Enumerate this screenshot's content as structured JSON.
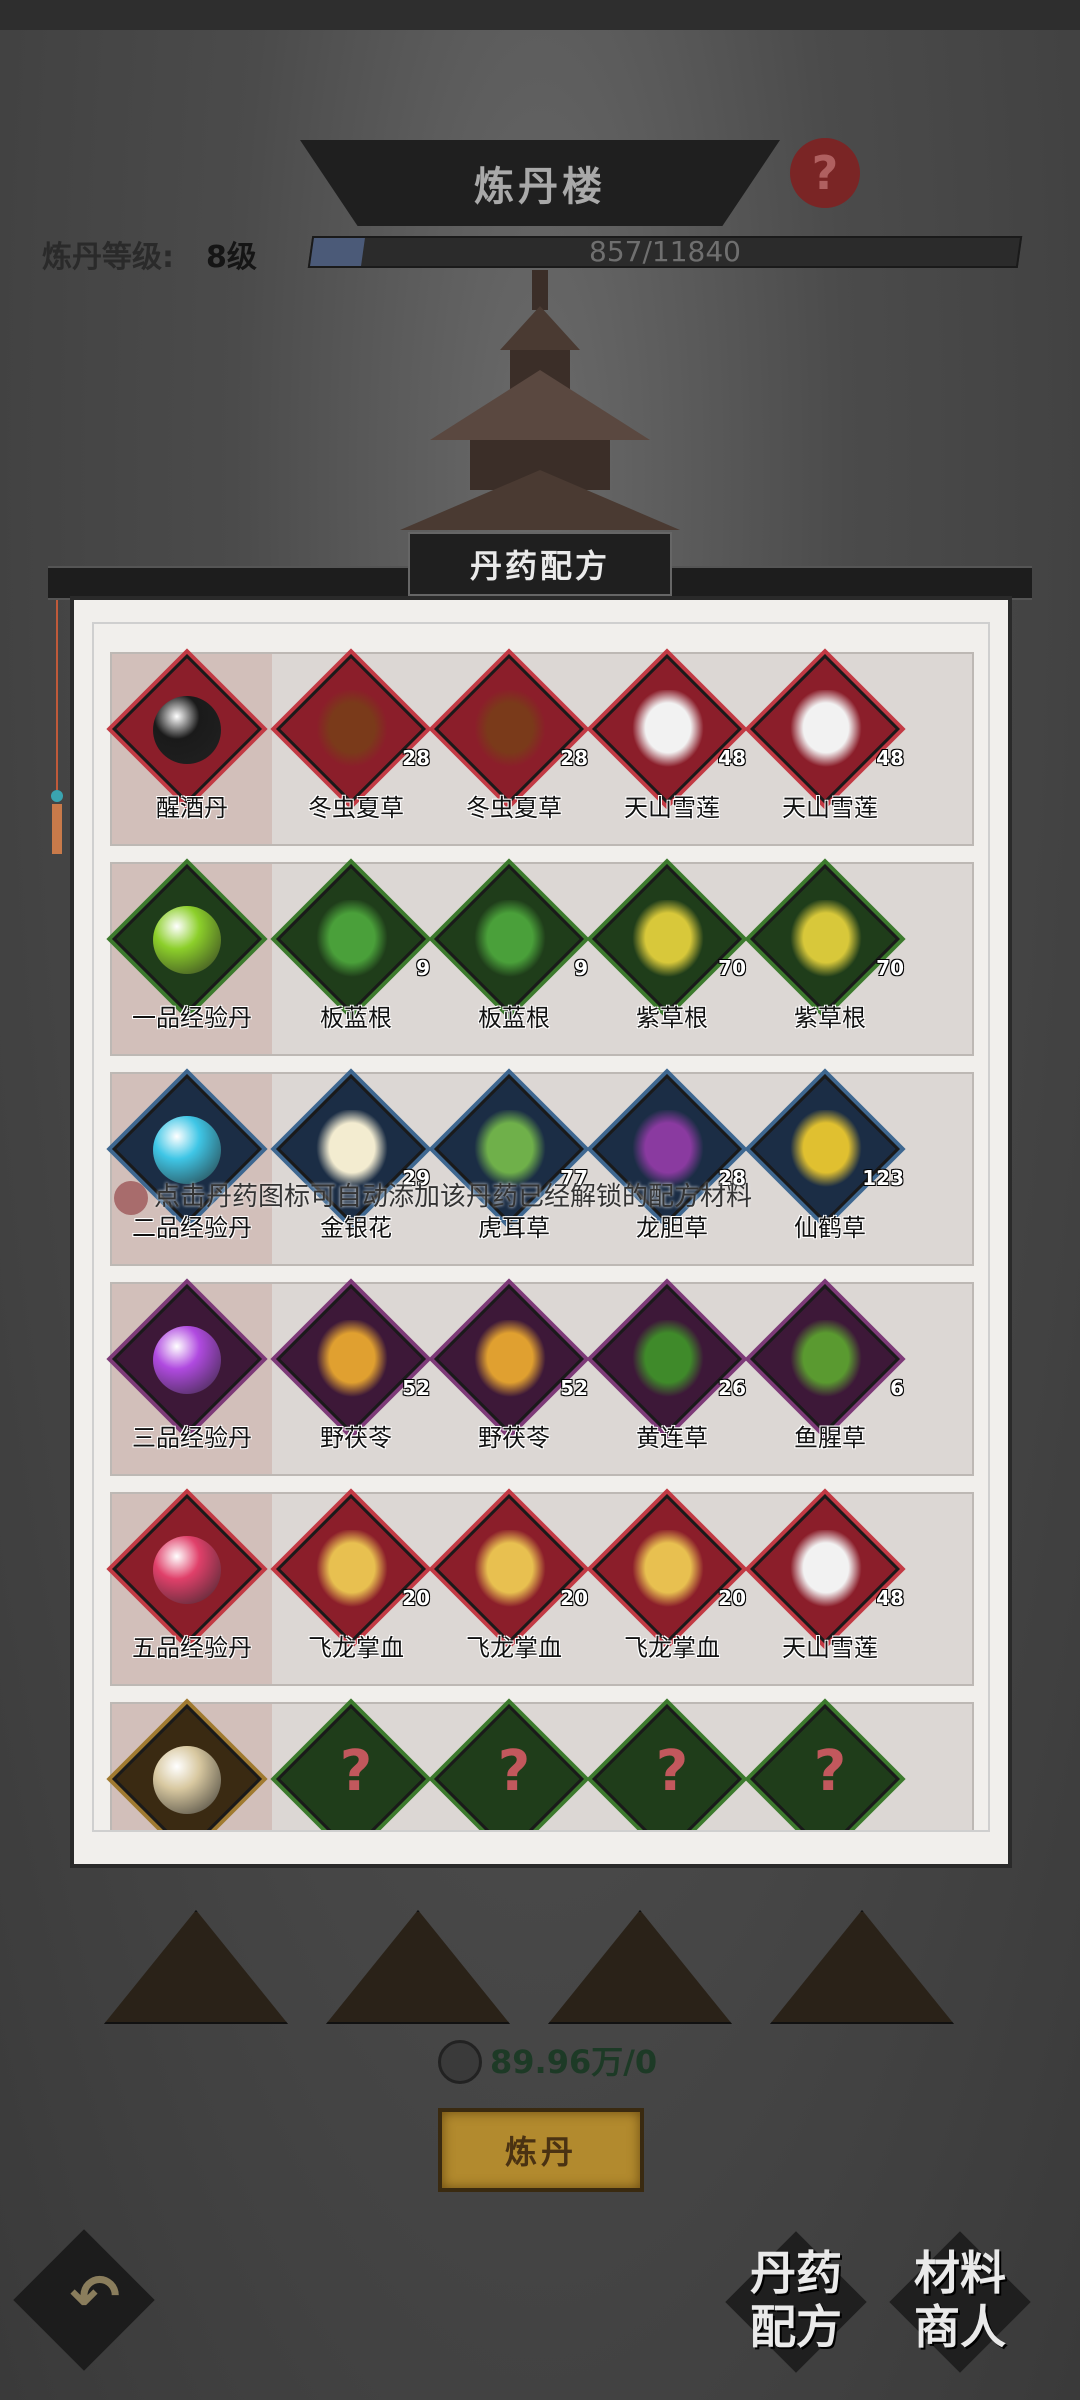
{
  "header": {
    "title": "炼丹楼",
    "help_icon": "?",
    "level_label": "炼丹等级:",
    "level_value": "8级",
    "xp_text": "857/11840",
    "xp_progress": 0.0724
  },
  "panel": {
    "title": "丹药配方",
    "hint_text": "点击丹药图标可自动添加该丹药已经解锁的配方材料"
  },
  "recipes": [
    {
      "pill": {
        "name": "醒酒丹",
        "color": "#1a1a1a",
        "frame": "red"
      },
      "ingredients": [
        {
          "name": "冬虫夏草",
          "count": "28",
          "frame": "red",
          "icon": "cordyceps-icon"
        },
        {
          "name": "冬虫夏草",
          "count": "28",
          "frame": "red",
          "icon": "cordyceps-icon"
        },
        {
          "name": "天山雪莲",
          "count": "48",
          "frame": "red",
          "icon": "snow-lotus-icon"
        },
        {
          "name": "天山雪莲",
          "count": "48",
          "frame": "red",
          "icon": "snow-lotus-icon"
        }
      ]
    },
    {
      "pill": {
        "name": "一品经验丹",
        "color": "#8ccf2a",
        "frame": "green"
      },
      "ingredients": [
        {
          "name": "板蓝根",
          "count": "9",
          "frame": "green",
          "icon": "isatis-root-icon"
        },
        {
          "name": "板蓝根",
          "count": "9",
          "frame": "green",
          "icon": "isatis-root-icon"
        },
        {
          "name": "紫草根",
          "count": "70",
          "frame": "green",
          "icon": "purple-gromwell-icon"
        },
        {
          "name": "紫草根",
          "count": "70",
          "frame": "green",
          "icon": "purple-gromwell-icon"
        }
      ]
    },
    {
      "pill": {
        "name": "二品经验丹",
        "color": "#3fc6e6",
        "frame": "blue"
      },
      "ingredients": [
        {
          "name": "金银花",
          "count": "29",
          "frame": "blue",
          "icon": "honeysuckle-icon"
        },
        {
          "name": "虎耳草",
          "count": "77",
          "frame": "blue",
          "icon": "saxifrage-icon"
        },
        {
          "name": "龙胆草",
          "count": "28",
          "frame": "blue",
          "icon": "gentian-icon"
        },
        {
          "name": "仙鹤草",
          "count": "123",
          "frame": "blue",
          "icon": "agrimony-icon"
        }
      ]
    },
    {
      "pill": {
        "name": "三品经验丹",
        "color": "#b04ae0",
        "frame": "purple"
      },
      "ingredients": [
        {
          "name": "野茯苓",
          "count": "52",
          "frame": "purple",
          "icon": "poria-icon"
        },
        {
          "name": "野茯苓",
          "count": "52",
          "frame": "purple",
          "icon": "poria-icon"
        },
        {
          "name": "黄连草",
          "count": "26",
          "frame": "purple",
          "icon": "coptis-icon"
        },
        {
          "name": "鱼腥草",
          "count": "6",
          "frame": "purple",
          "icon": "houttuynia-icon"
        }
      ]
    },
    {
      "pill": {
        "name": "五品经验丹",
        "color": "#e0406a",
        "frame": "red"
      },
      "ingredients": [
        {
          "name": "飞龙掌血",
          "count": "20",
          "frame": "red",
          "icon": "toddalia-icon"
        },
        {
          "name": "飞龙掌血",
          "count": "20",
          "frame": "red",
          "icon": "toddalia-icon"
        },
        {
          "name": "飞龙掌血",
          "count": "20",
          "frame": "red",
          "icon": "toddalia-icon"
        },
        {
          "name": "天山雪莲",
          "count": "48",
          "frame": "red",
          "icon": "snow-lotus-icon"
        }
      ]
    }
  ],
  "locked_row": {
    "question": "?",
    "frame": "green"
  },
  "footer": {
    "cost_text": "89.96万/0",
    "alchemy_button": "炼丹",
    "recipe_button_line1": "丹药",
    "recipe_button_line2": "配方",
    "merchant_button_line1": "材料",
    "merchant_button_line2": "商人"
  }
}
